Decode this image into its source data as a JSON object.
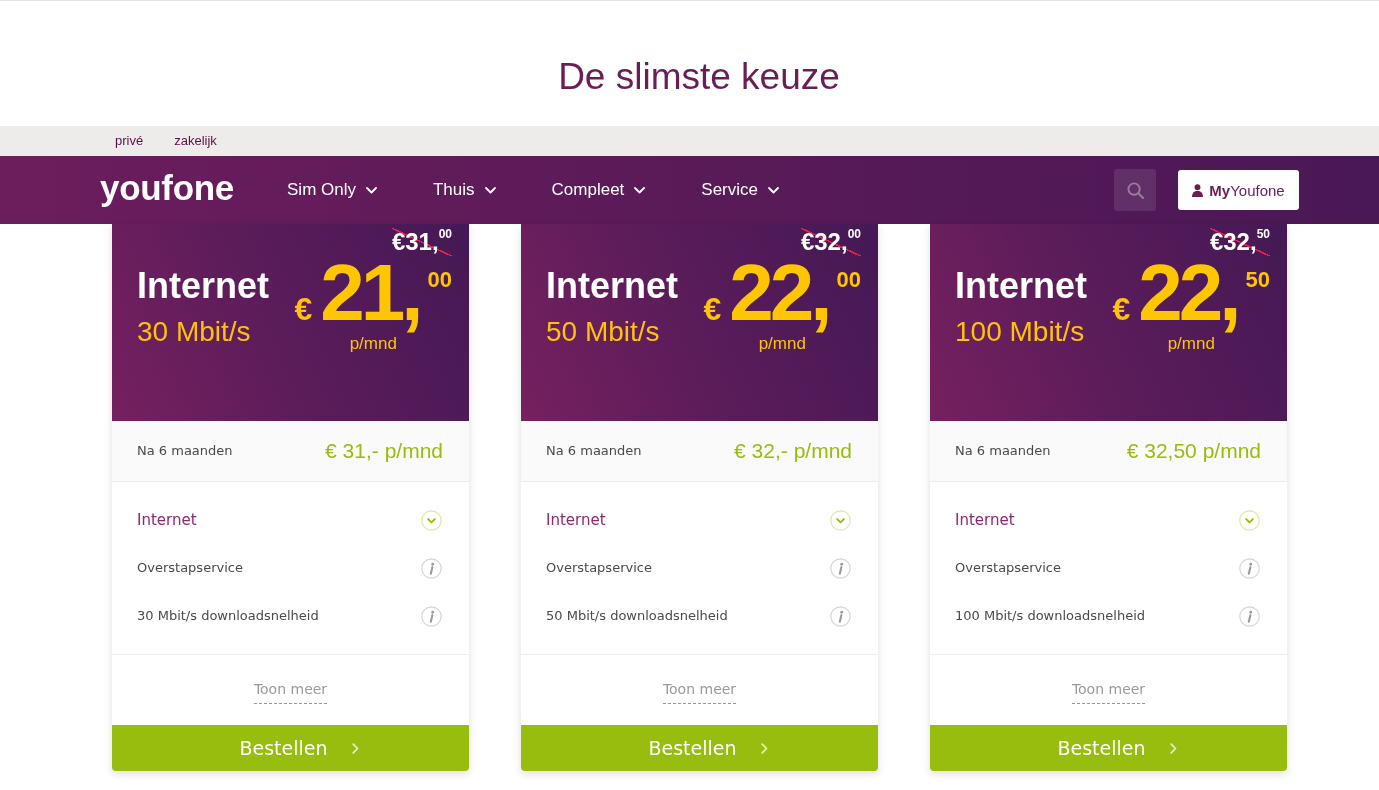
{
  "page": {
    "title": "De slimste keuze"
  },
  "segment_bar": {
    "links": [
      "privé",
      "zakelijk"
    ]
  },
  "nav": {
    "logo": "youfone",
    "items": [
      {
        "label": "Sim Only"
      },
      {
        "label": "Thuis"
      },
      {
        "label": "Compleet"
      },
      {
        "label": "Service"
      }
    ],
    "account_button": "**My**Youfone"
  },
  "plans": [
    {
      "old_price": "€31,$^{00}$",
      "product": "Internet",
      "speed": "30 Mbit/s",
      "price": {
        "currency": "€",
        "amount": "21,$^{00}$",
        "period": "p/mnd"
      },
      "after_label": "Na 6 maanden",
      "after_price": "€ 31,- p/mnd",
      "features": {
        "title": "Internet",
        "expanded": true,
        "items": [
          "Overstapservice",
          "30 Mbit/s downloadsnelheid"
        ]
      },
      "more_link": "Toon meer",
      "order_button": "Bestellen"
    },
    {
      "old_price": "€32,$^{00}$",
      "product": "Internet",
      "speed": "50 Mbit/s",
      "price": {
        "currency": "€",
        "amount": "22,$^{00}$",
        "period": "p/mnd"
      },
      "after_label": "Na 6 maanden",
      "after_price": "€ 32,- p/mnd",
      "features": {
        "title": "Internet",
        "expanded": true,
        "items": [
          "Overstapservice",
          "50 Mbit/s downloadsnelheid"
        ]
      },
      "more_link": "Toon meer",
      "order_button": "Bestellen"
    },
    {
      "old_price": "€32,$^{50}$",
      "product": "Internet",
      "speed": "100 Mbit/s",
      "price": {
        "currency": "€",
        "amount": "22,$^{50}$",
        "period": "p/mnd"
      },
      "after_label": "Na 6 maanden",
      "after_price": "€ 32,50 p/mnd",
      "features": {
        "title": "Internet",
        "expanded": true,
        "items": [
          "Overstapservice",
          "100 Mbit/s downloadsnelheid"
        ]
      },
      "more_link": "Toon meer",
      "order_button": "Bestellen"
    }
  ]
}
